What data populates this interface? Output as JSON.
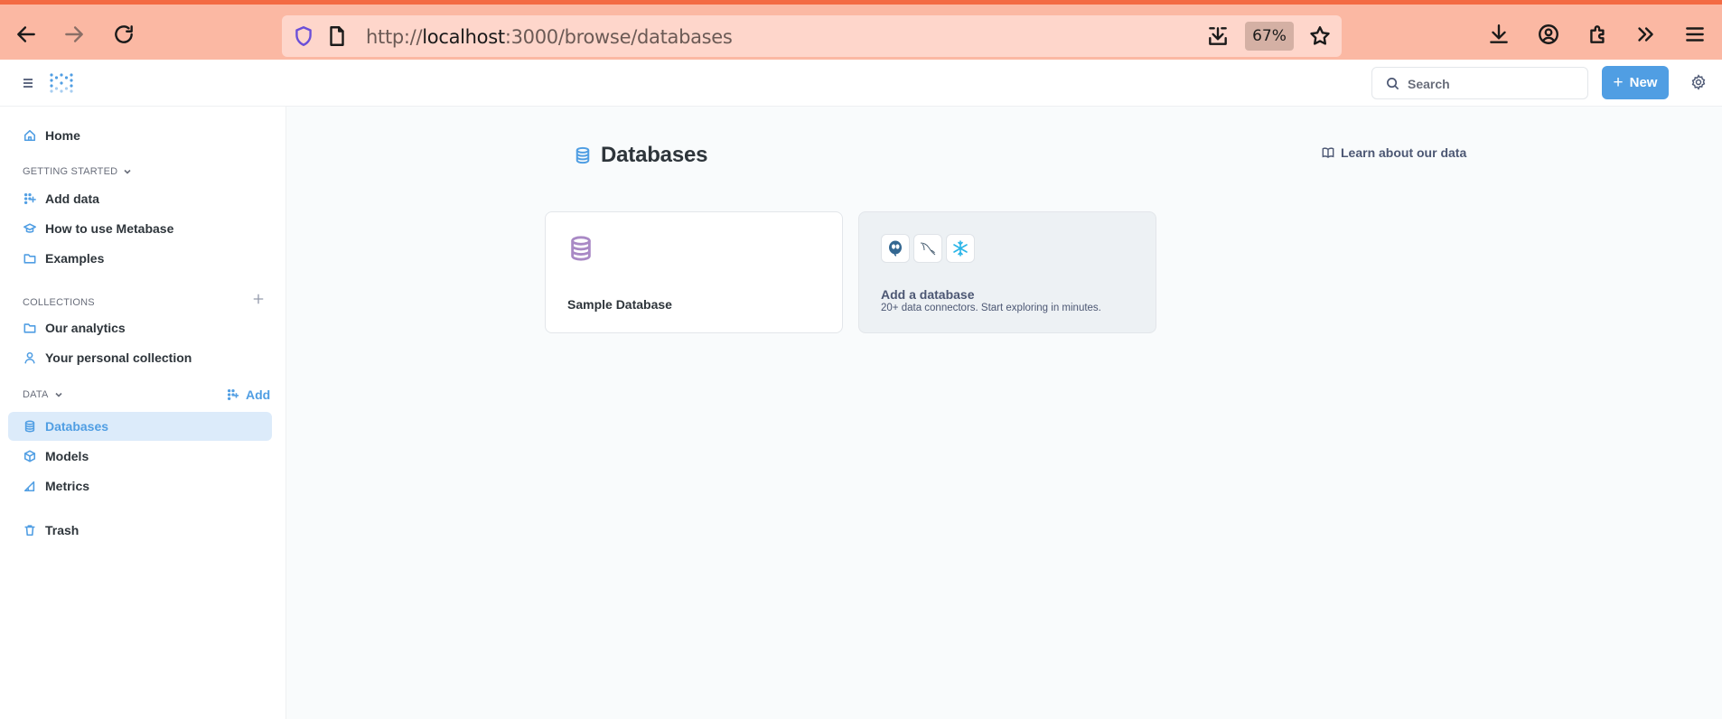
{
  "browser": {
    "url_prefix": "http://",
    "url_host": "localhost",
    "url_rest": ":3000/browse/databases",
    "zoom": "67%"
  },
  "header": {
    "search_label": "Search",
    "new_label": "New"
  },
  "sidebar": {
    "home": "Home",
    "getting_started": {
      "heading": "GETTING STARTED",
      "items": [
        "Add data",
        "How to use Metabase",
        "Examples"
      ]
    },
    "collections": {
      "heading": "COLLECTIONS",
      "items": [
        "Our analytics",
        "Your personal collection"
      ]
    },
    "data": {
      "heading": "DATA",
      "add_label": "Add",
      "items": [
        "Databases",
        "Models",
        "Metrics"
      ]
    },
    "trash": "Trash"
  },
  "main": {
    "title": "Databases",
    "learn_link": "Learn about our data",
    "cards": {
      "sample_db": "Sample Database",
      "add_db_title": "Add a database",
      "add_db_sub": "20+ data connectors. Start exploring in minutes."
    }
  },
  "colors": {
    "brand": "#509ee3",
    "browser_bar": "#fbb8a3",
    "browser_accent": "#f36a43",
    "active_bg": "#dcebfa",
    "db_icon_purple": "#a989c5"
  }
}
